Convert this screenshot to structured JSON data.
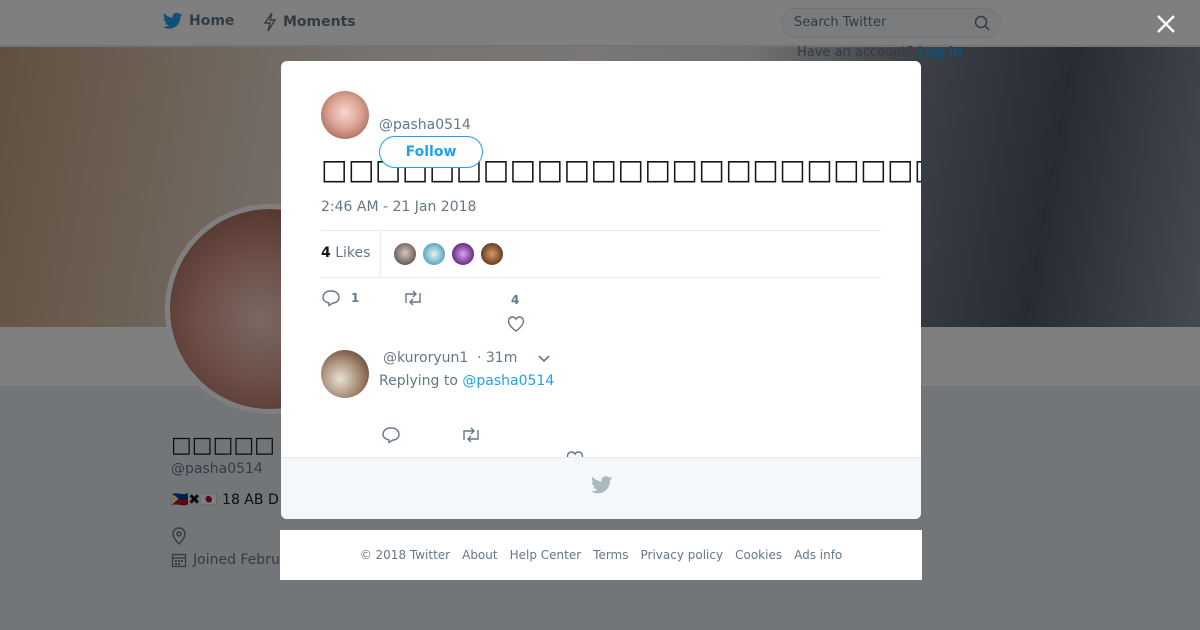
{
  "nav": {
    "home_label": "Home",
    "moments_label": "Moments",
    "search_placeholder": "Search Twitter",
    "login_text": "Have an account?",
    "login_link": "Log in",
    "brand_color": "#1da1f2"
  },
  "profile": {
    "name": "□□□□□",
    "handle": "@pasha0514",
    "bio": "🇵🇭✖🇯🇵 18 AB D",
    "joined": "Joined Febru"
  },
  "tweet": {
    "handle": "@pasha0514",
    "follow_label": "Follow",
    "text": "□□□□□□□□□□□□□□□□□□□□□□□□□□",
    "timestamp": "2:46 AM - 21 Jan 2018",
    "likes_number": "4",
    "likes_word": "Likes",
    "reply_count": "1",
    "like_count": "4"
  },
  "reply": {
    "handle": "@kuroryun1",
    "time": "· 31m",
    "replying_prefix": "Replying to",
    "replying_handle": "@pasha0514"
  },
  "footer": {
    "links": [
      "© 2018 Twitter",
      "About",
      "Help Center",
      "Terms",
      "Privacy policy",
      "Cookies",
      "Ads info"
    ]
  }
}
